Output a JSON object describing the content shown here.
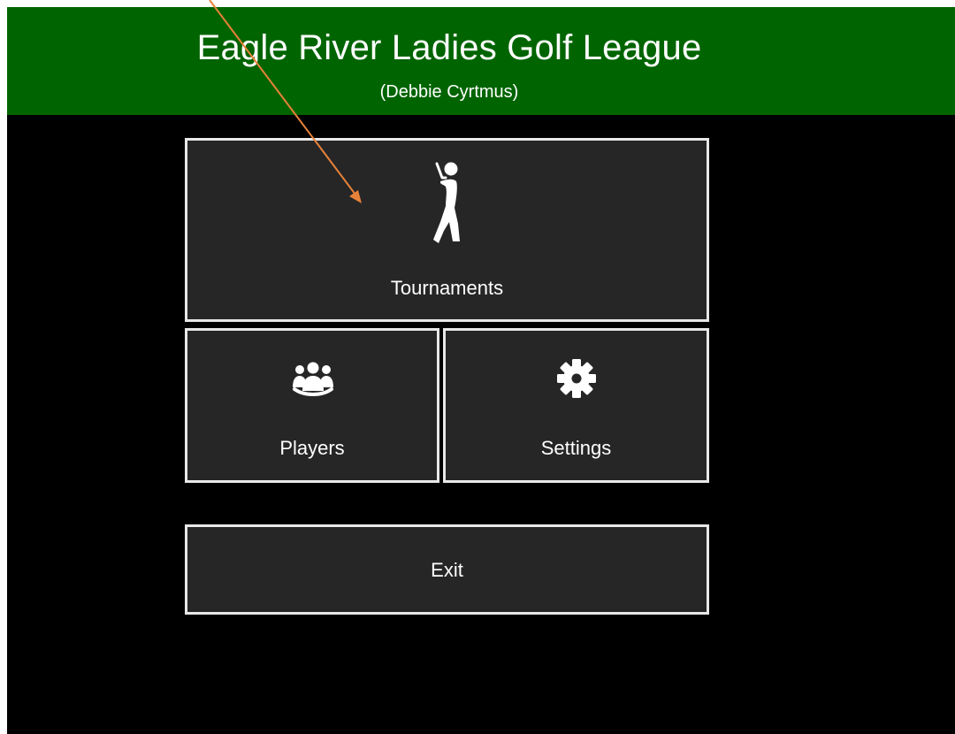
{
  "header": {
    "title": "Eagle River Ladies Golf League",
    "subtitle": "(Debbie Cyrtmus)"
  },
  "menu": {
    "tournaments": {
      "label": "Tournaments",
      "icon": "golfer-icon"
    },
    "players": {
      "label": "Players",
      "icon": "group-icon"
    },
    "settings": {
      "label": "Settings",
      "icon": "gear-icon"
    },
    "exit": {
      "label": "Exit"
    }
  },
  "annotation": {
    "type": "arrow",
    "target": "tournaments",
    "color": "#e8823a"
  },
  "colors": {
    "header_bg": "#006400",
    "app_bg": "#000000",
    "tile_bg": "#262626",
    "tile_border": "#e8e8e8",
    "text": "#ffffff"
  }
}
